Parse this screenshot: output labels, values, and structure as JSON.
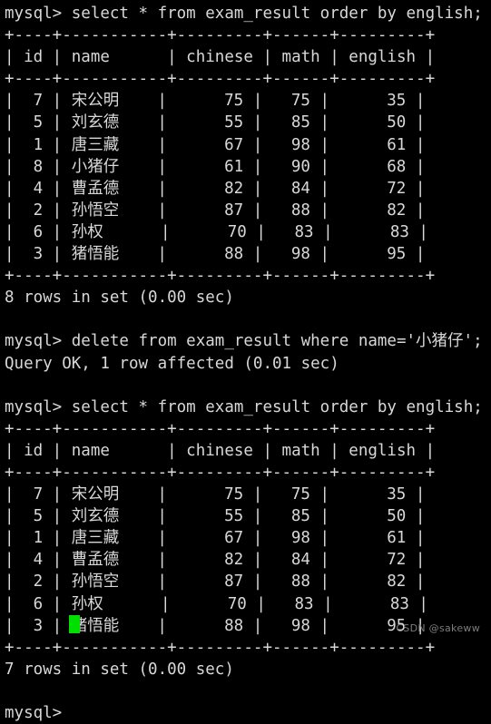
{
  "terminal": {
    "background_color": "#000000",
    "text_color": "#d8d8d8",
    "cursor_color": "#00e000",
    "prompt": "mysql> ",
    "watermark": "CSDN @sakeww"
  },
  "session": {
    "blocks": [
      {
        "prompt": "mysql> ",
        "command": "select * from exam_result order by english;",
        "status": "8 rows in set (0.00 sec)"
      },
      {
        "prompt": "mysql> ",
        "command": "delete from exam_result where name='小猪仔';",
        "status": "Query OK, 1 row affected (0.01 sec)"
      },
      {
        "prompt": "mysql> ",
        "command": "select * from exam_result order by english;",
        "status": "7 rows in set (0.00 sec)"
      }
    ]
  },
  "table1": {
    "separator": "+----+-----------+---------+------+---------+",
    "header": "| id | name      | chinese | math | english |",
    "columns": [
      "id",
      "name",
      "chinese",
      "math",
      "english"
    ],
    "rows": [
      {
        "id": 7,
        "name": "宋公明",
        "chinese": 75,
        "math": 75,
        "english": 35
      },
      {
        "id": 5,
        "name": "刘玄德",
        "chinese": 55,
        "math": 85,
        "english": 50
      },
      {
        "id": 1,
        "name": "唐三藏",
        "chinese": 67,
        "math": 98,
        "english": 61
      },
      {
        "id": 8,
        "name": "小猪仔",
        "chinese": 61,
        "math": 90,
        "english": 68
      },
      {
        "id": 4,
        "name": "曹孟德",
        "chinese": 82,
        "math": 84,
        "english": 72
      },
      {
        "id": 2,
        "name": "孙悟空",
        "chinese": 87,
        "math": 88,
        "english": 82
      },
      {
        "id": 6,
        "name": "孙权",
        "chinese": 70,
        "math": 83,
        "english": 83
      },
      {
        "id": 3,
        "name": "猪悟能",
        "chinese": 88,
        "math": 98,
        "english": 95
      }
    ],
    "rendered_rows": [
      "|  7 | 宋公明    |      75 |   75 |      35 |",
      "|  5 | 刘玄德    |      55 |   85 |      50 |",
      "|  1 | 唐三藏    |      67 |   98 |      61 |",
      "|  8 | 小猪仔    |      61 |   90 |      68 |",
      "|  4 | 曹孟德    |      82 |   84 |      72 |",
      "|  2 | 孙悟空    |      87 |   88 |      82 |",
      "|  6 | 孙权      |      70 |   83 |      83 |",
      "|  3 | 猪悟能    |      88 |   98 |      95 |"
    ]
  },
  "table2": {
    "separator": "+----+-----------+---------+------+---------+",
    "header": "| id | name      | chinese | math | english |",
    "columns": [
      "id",
      "name",
      "chinese",
      "math",
      "english"
    ],
    "rows": [
      {
        "id": 7,
        "name": "宋公明",
        "chinese": 75,
        "math": 75,
        "english": 35
      },
      {
        "id": 5,
        "name": "刘玄德",
        "chinese": 55,
        "math": 85,
        "english": 50
      },
      {
        "id": 1,
        "name": "唐三藏",
        "chinese": 67,
        "math": 98,
        "english": 61
      },
      {
        "id": 4,
        "name": "曹孟德",
        "chinese": 82,
        "math": 84,
        "english": 72
      },
      {
        "id": 2,
        "name": "孙悟空",
        "chinese": 87,
        "math": 88,
        "english": 82
      },
      {
        "id": 6,
        "name": "孙权",
        "chinese": 70,
        "math": 83,
        "english": 83
      },
      {
        "id": 3,
        "name": "猪悟能",
        "chinese": 88,
        "math": 98,
        "english": 95
      }
    ],
    "rendered_rows": [
      "|  7 | 宋公明    |      75 |   75 |      35 |",
      "|  5 | 刘玄德    |      55 |   85 |      50 |",
      "|  1 | 唐三藏    |      67 |   98 |      61 |",
      "|  4 | 曹孟德    |      82 |   84 |      72 |",
      "|  2 | 孙悟空    |      87 |   88 |      82 |",
      "|  6 | 孙权      |      70 |   83 |      83 |",
      "|  3 | 猪悟能    |      88 |   98 |      95 |"
    ]
  },
  "lines": [
    "mysql> select * from exam_result order by english;",
    "+----+-----------+---------+------+---------+",
    "| id | name      | chinese | math | english |",
    "+----+-----------+---------+------+---------+",
    "|  7 | 宋公明    |      75 |   75 |      35 |",
    "|  5 | 刘玄德    |      55 |   85 |      50 |",
    "|  1 | 唐三藏    |      67 |   98 |      61 |",
    "|  8 | 小猪仔    |      61 |   90 |      68 |",
    "|  4 | 曹孟德    |      82 |   84 |      72 |",
    "|  2 | 孙悟空    |      87 |   88 |      82 |",
    "|  6 | 孙权      |      70 |   83 |      83 |",
    "|  3 | 猪悟能    |      88 |   98 |      95 |",
    "+----+-----------+---------+------+---------+",
    "8 rows in set (0.00 sec)",
    " ",
    "mysql> delete from exam_result where name='小猪仔';",
    "Query OK, 1 row affected (0.01 sec)",
    " ",
    "mysql> select * from exam_result order by english;",
    "+----+-----------+---------+------+---------+",
    "| id | name      | chinese | math | english |",
    "+----+-----------+---------+------+---------+",
    "|  7 | 宋公明    |      75 |   75 |      35 |",
    "|  5 | 刘玄德    |      55 |   85 |      50 |",
    "|  1 | 唐三藏    |      67 |   98 |      61 |",
    "|  4 | 曹孟德    |      82 |   84 |      72 |",
    "|  2 | 孙悟空    |      87 |   88 |      82 |",
    "|  6 | 孙权      |      70 |   83 |      83 |",
    "|  3 | 猪悟能    |      88 |   98 |      95 |",
    "+----+-----------+---------+------+---------+",
    "7 rows in set (0.00 sec)",
    " ",
    "mysql> "
  ]
}
